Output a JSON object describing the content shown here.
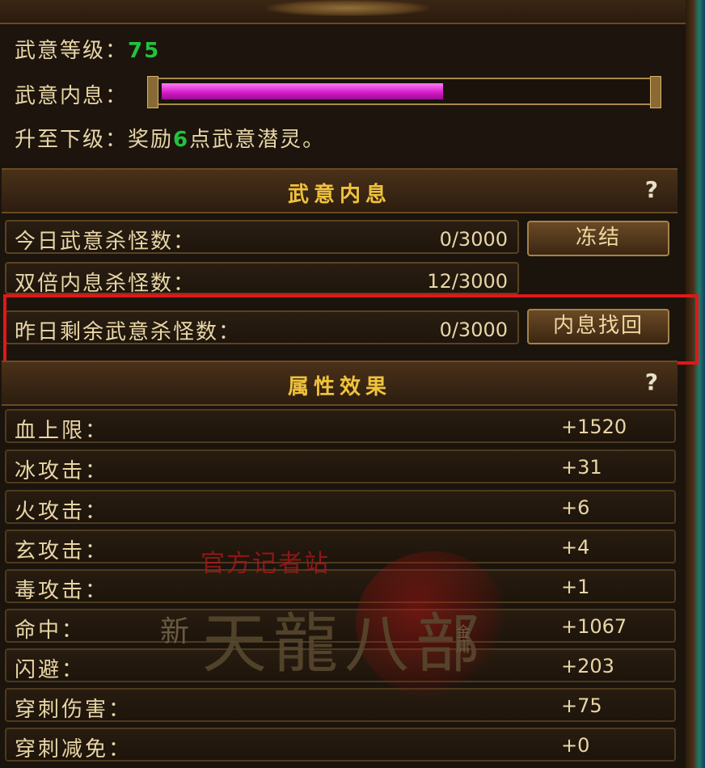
{
  "info": {
    "level_label": "武意等级：",
    "level_value": "75",
    "neixi_label": "武意内息：",
    "neixi_progress": 0.58,
    "next_label": "升至下级：奖励",
    "next_points": "6",
    "next_suffix": "点武意潜灵。"
  },
  "section1": {
    "title": "武意内息",
    "help": "?",
    "rows": [
      {
        "label": "今日武意杀怪数：",
        "value": "0/3000",
        "button": "冻结"
      },
      {
        "label": "双倍内息杀怪数：",
        "value": "12/3000"
      },
      {
        "label": "昨日剩余武意杀怪数：",
        "value": "0/3000",
        "button": "内息找回"
      }
    ]
  },
  "section2": {
    "title": "属性效果",
    "help": "?",
    "rows": [
      {
        "label": "血上限：",
        "value": "+1520"
      },
      {
        "label": "冰攻击：",
        "value": "+31"
      },
      {
        "label": "火攻击：",
        "value": "+6"
      },
      {
        "label": "玄攻击：",
        "value": "+4"
      },
      {
        "label": "毒攻击：",
        "value": "+1"
      },
      {
        "label": "命中：",
        "value": "+1067"
      },
      {
        "label": "闪避：",
        "value": "+203"
      },
      {
        "label": "穿刺伤害：",
        "value": "+75"
      },
      {
        "label": "穿刺减免：",
        "value": "+0"
      }
    ]
  },
  "watermark": {
    "site": "官方记者站",
    "main": "天龍八部",
    "prefix": "新",
    "side": "金庸"
  },
  "colors": {
    "accent": "#f0c23c",
    "green": "#22c33b",
    "bar": "#d318c6",
    "highlight": "#e01818"
  }
}
